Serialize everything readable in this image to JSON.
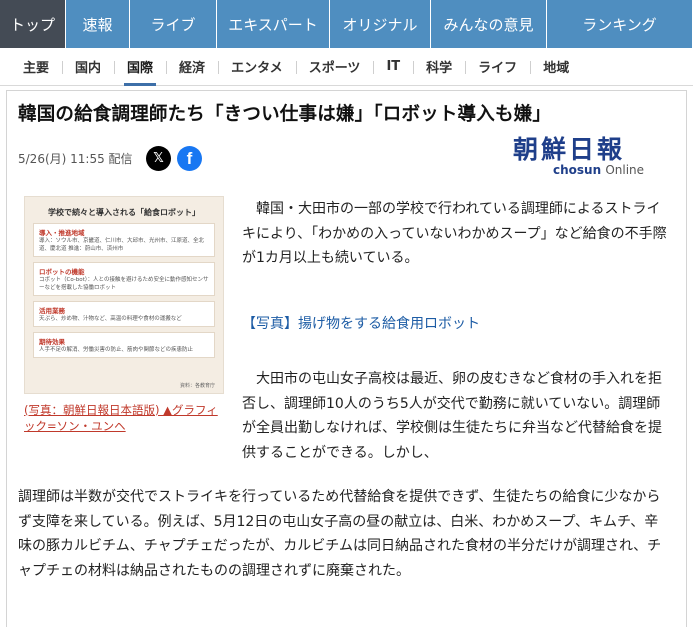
{
  "topnav": {
    "tabs": [
      {
        "label": "トップ",
        "width": 66
      },
      {
        "label": "速報",
        "width": 64
      },
      {
        "label": "ライブ",
        "width": 87
      },
      {
        "label": "エキスパート",
        "width": 113
      },
      {
        "label": "オリジナル",
        "width": 101
      },
      {
        "label": "みんなの意見",
        "width": 116
      },
      {
        "label": "ランキング",
        "width": 146
      }
    ]
  },
  "subnav": {
    "items": [
      "主要",
      "国内",
      "国際",
      "経済",
      "エンタメ",
      "スポーツ",
      "IT",
      "科学",
      "ライフ",
      "地域"
    ]
  },
  "article": {
    "headline": "韓国の給食調理師たち「きつい仕事は嫌」「ロボット導入も嫌」",
    "meta": "5/26(月) 11:55 配信",
    "share_x": "𝕏",
    "share_fb": "f",
    "source_logo_kanji": "朝鮮日報",
    "source_logo_en": "chosun",
    "source_logo_online": "Online",
    "photo": {
      "title": "学校で続々と導入される「給食ロボット」",
      "boxes": [
        {
          "heading": "導入・推進地域",
          "text": "導入：ソウル市、京畿道、仁川市、大邱市、光州市、江原道、全北道、慶北道 推進：蔚山市、済州市"
        },
        {
          "heading": "ロボットの機能",
          "text": "コボット（Co-bot）：人との接触を避けるため安全に動作感知センサーなどを搭載した協働ロボット"
        },
        {
          "heading": "活用業務",
          "text": "天ぷら、炒め物、汁物など、高温の料理や食材の運搬など"
        },
        {
          "heading": "期待効果",
          "text": "人手不足の解消、労働災害の防止、筋肉や関節などの疾患防止"
        }
      ],
      "credit": "資料：各教育庁"
    },
    "caption": "(写真：朝鮮日報日本語版) ▲グラフィック=ソン・ユンヘ",
    "para1": "韓国・大田市の一部の学校で行われている調理師によるストライキにより、「わかめの入っていないわかめスープ」など給食の不手際が1カ月以上も続いている。",
    "photo_link": "【写真】揚げ物をする給食用ロボット",
    "para2a": "大田市の屯山女子高校は最近、卵の皮むきなど食材の手入れを拒否し、調理師10人のうち5人が交代で勤務に就いていない。調理師が全員出勤しなければ、学校側は生徒たちに弁当など代替給食を提供することができる。しかし、",
    "para2b": "調理師は半数が交代でストライキを行っているため代替給食を提供できず、生徒たちの給食に少なからず支障を来している。例えば、5月12日の屯山女子高の昼の献立は、白米、わかめスープ、キムチ、辛味の豚カルビチム、チャプチェだったが、カルビチムは同日納品された食材の半分だけが調理され、チャプチェの材料は納品されたものの調理されずに廃棄された。"
  }
}
